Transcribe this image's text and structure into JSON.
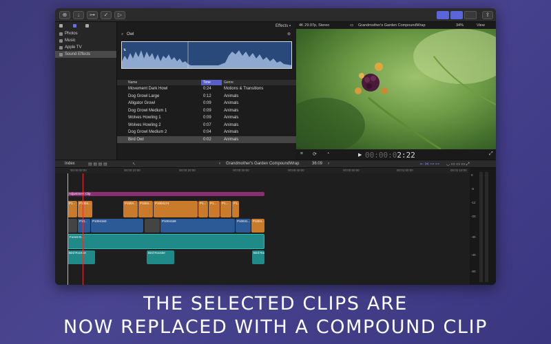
{
  "library": {
    "items": [
      {
        "label": "Photos"
      },
      {
        "label": "Music"
      },
      {
        "label": "Apple TV"
      },
      {
        "label": "Sound Effects"
      }
    ]
  },
  "browser": {
    "header": "Effects",
    "search_value": "Owl",
    "columns": {
      "name": "Name",
      "time": "Time",
      "genre": "Genre"
    },
    "rows": [
      {
        "name": "Movement Dark Howl",
        "time": "0:24",
        "genre": "Motions & Transitions"
      },
      {
        "name": "Dog Growl Large",
        "time": "0:12",
        "genre": "Animals"
      },
      {
        "name": "Alligator Growl",
        "time": "0:09",
        "genre": "Animals"
      },
      {
        "name": "Dog Growl Medium 1",
        "time": "0:09",
        "genre": "Animals"
      },
      {
        "name": "Wolves Howling 1",
        "time": "0:09",
        "genre": "Animals"
      },
      {
        "name": "Wolves Howling 2",
        "time": "0:07",
        "genre": "Animals"
      },
      {
        "name": "Dog Growl Medium 2",
        "time": "0:04",
        "genre": "Animals"
      },
      {
        "name": "Bird Owl",
        "time": "0:02",
        "genre": "Animals"
      }
    ]
  },
  "viewer": {
    "format": "4K 29.97p, Stereo",
    "title": "Grandmother's Garden CompoundWrap",
    "zoom": "34%",
    "view": "View",
    "timecode_dim": "00:00:0",
    "timecode": "2:22"
  },
  "timeline": {
    "index": "Index",
    "title": "Grandmother's Garden CompoundWrap",
    "duration": "36:09",
    "ruler": [
      "00:00:00:00",
      "00:00:10:00",
      "00:00:20:00",
      "00:00:30:00",
      "00:00:40:00",
      "00:00:50:00",
      "00:01:00:00",
      "00:01:10:00"
    ],
    "clips": {
      "adjustment": "Adjustment Clip",
      "b1": "P1...",
      "b2": "P1004...",
      "b3": "P1004...",
      "b4": "P1004...",
      "b5": "P1004174",
      "b6": "P1...",
      "b7": "P1...",
      "b8": "P1...",
      "b9": "P1...",
      "p1": "P10...",
      "p2": "P1004163",
      "p3": "P1004169",
      "p4": "P10041...",
      "p5": "P1004...",
      "forest": "Forest D...",
      "r1": "Bird Rooster",
      "r2": "Bird Rooster",
      "r3": "Bird Rooster"
    }
  },
  "meters": {
    "labels": [
      "0",
      "-6",
      "-12",
      "-20",
      "-30",
      "-40",
      "-50"
    ]
  },
  "caption": {
    "line1": "THE SELECTED CLIPS ARE",
    "line2": "NOW REPLACED WITH A COMPOUND CLIP"
  },
  "colors": {
    "accent": "#5860c8",
    "orange": "#c97a2a",
    "blue": "#2c5a96",
    "teal": "#1f8a87",
    "purple": "#8a2f74"
  }
}
